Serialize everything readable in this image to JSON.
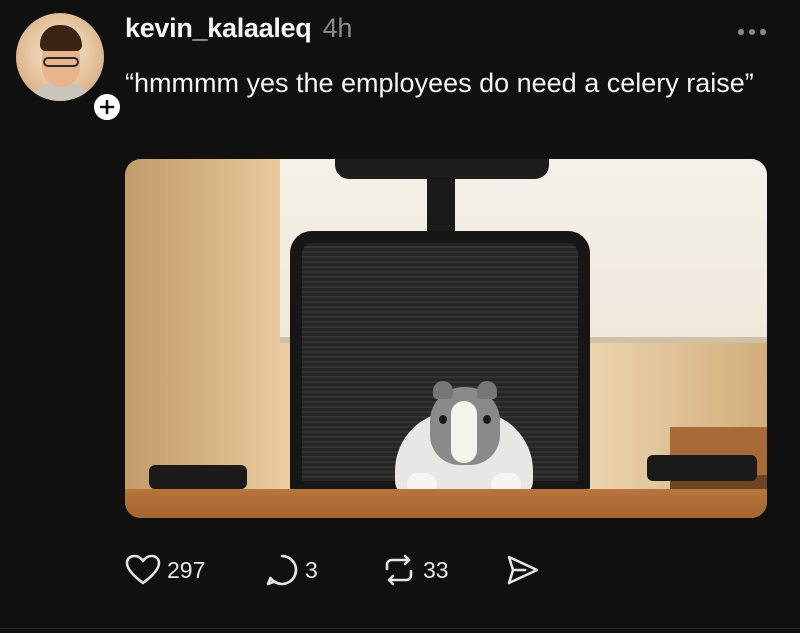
{
  "post": {
    "username": "kevin_kalaaleq",
    "timestamp": "4h",
    "text": "“hmmmm yes the employees do need a celery raise”"
  },
  "media": {
    "description_icon": "photo"
  },
  "actions": {
    "likes": "297",
    "replies": "3",
    "reposts": "33"
  },
  "icons": {
    "follow": "plus-icon",
    "more": "more-dots-icon",
    "like": "heart-icon",
    "reply": "comment-icon",
    "repost": "repost-icon",
    "share": "send-icon"
  },
  "colors": {
    "background": "#101010",
    "text": "#f3f3f3",
    "muted": "#8a8a8a"
  }
}
